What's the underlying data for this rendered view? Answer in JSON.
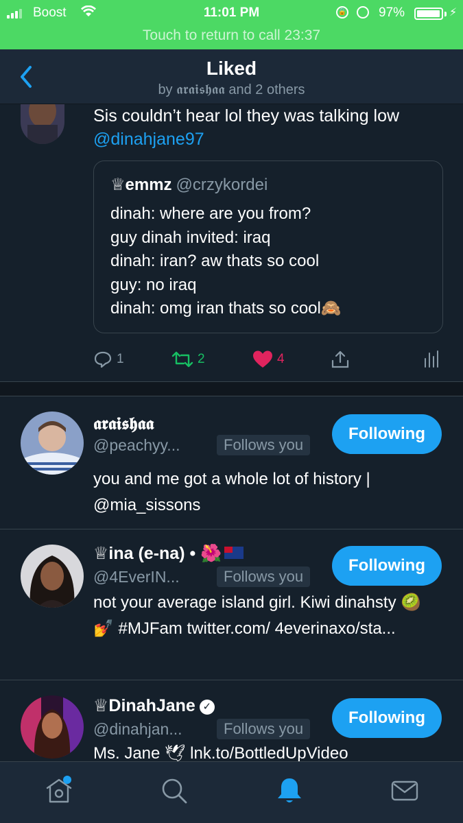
{
  "status_bar": {
    "carrier": "Boost",
    "time": "11:01 PM",
    "battery_pct": "97%",
    "battery_level": 0.97,
    "return_to_call": "Touch to return to call 23:37",
    "color": "#4cd964"
  },
  "header": {
    "title": "Liked",
    "subtitle": "by 𝖆𝖗𝖆𝖎𝖘𝖍𝖆𝖆 and 2 others",
    "back_icon": "chevron-left-icon"
  },
  "tweet": {
    "text_before": "Sis couldn’t hear lol they was talking low ",
    "mention": "@dinahjane97",
    "quote": {
      "name": "♕emmz",
      "handle": "@crzykordei",
      "lines": [
        "dinah: where are you from?",
        "guy dinah invited: iraq",
        "dinah: iran? aw thats so cool",
        "guy: no iraq",
        "dinah: omg iran thats so cool🙈"
      ]
    },
    "actions": {
      "reply_count": "1",
      "retweet_count": "2",
      "like_count": "4",
      "icons": [
        "reply-icon",
        "retweet-icon",
        "heart-icon",
        "share-icon",
        "analytics-icon"
      ]
    }
  },
  "users": [
    {
      "name": "𝖆𝖗𝖆𝖎𝖘𝖍𝖆𝖆",
      "handle": "@peachyy...",
      "badge": "Follows you",
      "button": "Following",
      "bio": "you and me got a whole lot of history | @mia_sissons"
    },
    {
      "name": "♕ina (e-na) • 🌺",
      "handle": "@4EverIN...",
      "badge": "Follows you",
      "button": "Following",
      "bio": "not your average island girl. Kiwi dinahsty 🥝 💅 #MJFam twitter.com/ 4everinaxo/sta..."
    },
    {
      "name": "♕DinahJane",
      "handle": "@dinahjan...",
      "badge": "Follows you",
      "button": "Following",
      "bio": "Ms. Jane 🕊 lnk.to/BottledUpVideo"
    }
  ],
  "tab_bar": {
    "icons": [
      "home-icon",
      "search-icon",
      "notifications-icon",
      "messages-icon"
    ],
    "active": "notifications-icon",
    "accent": "#1da1f2"
  }
}
